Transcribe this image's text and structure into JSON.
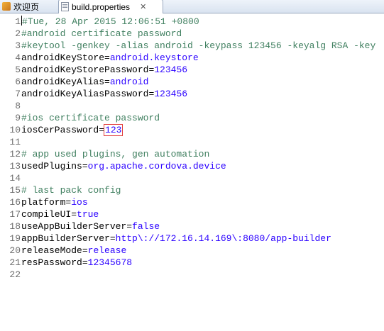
{
  "tabs": [
    {
      "label": "欢迎页",
      "icon": "welcome-icon"
    },
    {
      "label": "build.properties",
      "icon": "file-icon",
      "close": "✕"
    }
  ],
  "lines": [
    {
      "num": "1",
      "comment": "#Tue, 28 Apr 2015 12:06:51 +0800"
    },
    {
      "num": "2",
      "comment": "#android certificate password"
    },
    {
      "num": "3",
      "comment": "#keytool -genkey -alias android -keypass 123456 -keyalg RSA -key"
    },
    {
      "num": "4",
      "key": "androidKeyStore",
      "value": "android.keystore"
    },
    {
      "num": "5",
      "key": "androidKeyStorePassword",
      "value": "123456"
    },
    {
      "num": "6",
      "key": "androidKeyAlias",
      "value": "android"
    },
    {
      "num": "7",
      "key": "androidKeyAliasPassword",
      "value": "123456"
    },
    {
      "num": "8"
    },
    {
      "num": "9",
      "comment": "#ios certificate password"
    },
    {
      "num": "10",
      "key": "iosCerPassword",
      "value": "123"
    },
    {
      "num": "11"
    },
    {
      "num": "12",
      "comment": "# app used plugins, gen automation"
    },
    {
      "num": "13",
      "key": "usedPlugins",
      "value": "org.apache.cordova.device"
    },
    {
      "num": "14"
    },
    {
      "num": "15",
      "comment": "# last pack config"
    },
    {
      "num": "16",
      "key": "platform",
      "value": "ios"
    },
    {
      "num": "17",
      "key": "compileUI",
      "value": "true"
    },
    {
      "num": "18",
      "key": "useAppBuilderServer",
      "value": "false"
    },
    {
      "num": "19",
      "key": "appBuilderServer",
      "value": "http\\://172.16.14.169\\:8080/app-builder"
    },
    {
      "num": "20",
      "key": "releaseMode",
      "value": "release"
    },
    {
      "num": "21",
      "key": "resPassword",
      "value": "12345678"
    },
    {
      "num": "22"
    }
  ],
  "colors": {
    "comment": "#3f7f5f",
    "value": "#2a00ff",
    "highlight_box": "#e23a3a"
  }
}
